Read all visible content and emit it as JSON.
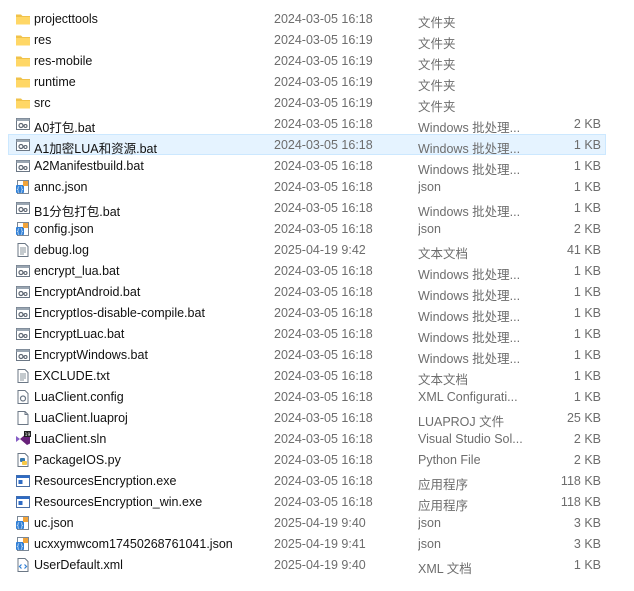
{
  "files": [
    {
      "name": "projecttools",
      "date": "2024-03-05 16:18",
      "type": "文件夹",
      "size": "",
      "icon": "folder-icon"
    },
    {
      "name": "res",
      "date": "2024-03-05 16:19",
      "type": "文件夹",
      "size": "",
      "icon": "folder-icon"
    },
    {
      "name": "res-mobile",
      "date": "2024-03-05 16:19",
      "type": "文件夹",
      "size": "",
      "icon": "folder-icon"
    },
    {
      "name": "runtime",
      "date": "2024-03-05 16:19",
      "type": "文件夹",
      "size": "",
      "icon": "folder-icon"
    },
    {
      "name": "src",
      "date": "2024-03-05 16:19",
      "type": "文件夹",
      "size": "",
      "icon": "folder-icon"
    },
    {
      "name": "A0打包.bat",
      "date": "2024-03-05 16:18",
      "type": "Windows 批处理...",
      "size": "2 KB",
      "icon": "batch-file-icon"
    },
    {
      "name": "A1加密LUA和资源.bat",
      "date": "2024-03-05 16:18",
      "type": "Windows 批处理...",
      "size": "1 KB",
      "icon": "batch-file-icon",
      "selected": true
    },
    {
      "name": "A2Manifestbuild.bat",
      "date": "2024-03-05 16:18",
      "type": "Windows 批处理...",
      "size": "1 KB",
      "icon": "batch-file-icon"
    },
    {
      "name": "annc.json",
      "date": "2024-03-05 16:18",
      "type": "json",
      "size": "1 KB",
      "icon": "json-file-icon"
    },
    {
      "name": "B1分包打包.bat",
      "date": "2024-03-05 16:18",
      "type": "Windows 批处理...",
      "size": "1 KB",
      "icon": "batch-file-icon"
    },
    {
      "name": "config.json",
      "date": "2024-03-05 16:18",
      "type": "json",
      "size": "2 KB",
      "icon": "json-file-icon"
    },
    {
      "name": "debug.log",
      "date": "2025-04-19 9:42",
      "type": "文本文档",
      "size": "41 KB",
      "icon": "text-file-icon"
    },
    {
      "name": "encrypt_lua.bat",
      "date": "2024-03-05 16:18",
      "type": "Windows 批处理...",
      "size": "1 KB",
      "icon": "batch-file-icon"
    },
    {
      "name": "EncryptAndroid.bat",
      "date": "2024-03-05 16:18",
      "type": "Windows 批处理...",
      "size": "1 KB",
      "icon": "batch-file-icon"
    },
    {
      "name": "EncryptIos-disable-compile.bat",
      "date": "2024-03-05 16:18",
      "type": "Windows 批处理...",
      "size": "1 KB",
      "icon": "batch-file-icon"
    },
    {
      "name": "EncryptLuac.bat",
      "date": "2024-03-05 16:18",
      "type": "Windows 批处理...",
      "size": "1 KB",
      "icon": "batch-file-icon"
    },
    {
      "name": "EncryptWindows.bat",
      "date": "2024-03-05 16:18",
      "type": "Windows 批处理...",
      "size": "1 KB",
      "icon": "batch-file-icon"
    },
    {
      "name": "EXCLUDE.txt",
      "date": "2024-03-05 16:18",
      "type": "文本文档",
      "size": "1 KB",
      "icon": "text-file-icon"
    },
    {
      "name": "LuaClient.config",
      "date": "2024-03-05 16:18",
      "type": "XML Configurati...",
      "size": "1 KB",
      "icon": "config-file-icon"
    },
    {
      "name": "LuaClient.luaproj",
      "date": "2024-03-05 16:18",
      "type": "LUAPROJ 文件",
      "size": "25 KB",
      "icon": "blank-file-icon"
    },
    {
      "name": "LuaClient.sln",
      "date": "2024-03-05 16:18",
      "type": "Visual Studio Sol...",
      "size": "2 KB",
      "icon": "visual-studio-icon"
    },
    {
      "name": "PackageIOS.py",
      "date": "2024-03-05 16:18",
      "type": "Python File",
      "size": "2 KB",
      "icon": "python-file-icon"
    },
    {
      "name": "ResourcesEncryption.exe",
      "date": "2024-03-05 16:18",
      "type": "应用程序",
      "size": "118 KB",
      "icon": "exe-file-icon"
    },
    {
      "name": "ResourcesEncryption_win.exe",
      "date": "2024-03-05 16:18",
      "type": "应用程序",
      "size": "118 KB",
      "icon": "exe-file-icon"
    },
    {
      "name": "uc.json",
      "date": "2025-04-19 9:40",
      "type": "json",
      "size": "3 KB",
      "icon": "json-file-icon"
    },
    {
      "name": "ucxxymwcom17450268761041.json",
      "date": "2025-04-19 9:41",
      "type": "json",
      "size": "3 KB",
      "icon": "json-file-icon"
    },
    {
      "name": "UserDefault.xml",
      "date": "2025-04-19 9:40",
      "type": "XML 文档",
      "size": "1 KB",
      "icon": "xml-file-icon"
    }
  ]
}
